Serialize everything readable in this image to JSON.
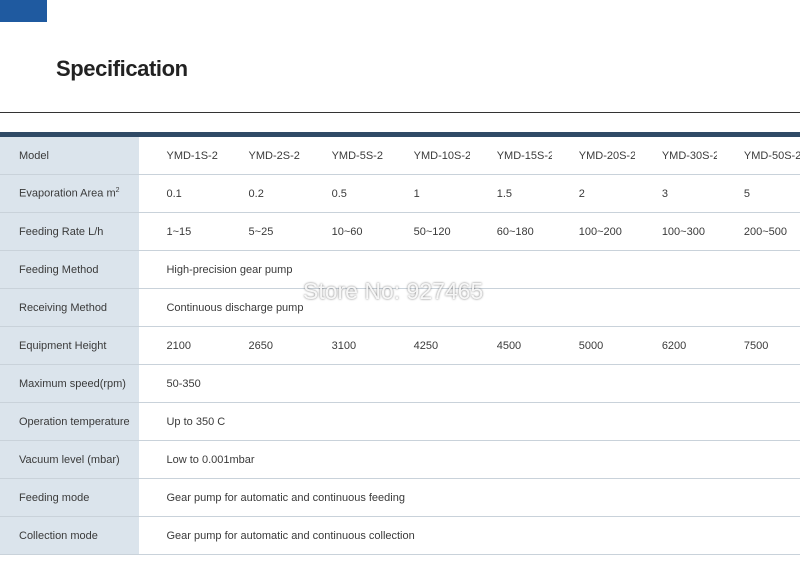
{
  "page": {
    "title": "Specification"
  },
  "watermark": "Store No: 927465",
  "table": {
    "rows": [
      {
        "label": "Model",
        "values": [
          "YMD-1S-2",
          "YMD-2S-2",
          "YMD-5S-2",
          "YMD-10S-2",
          "YMD-15S-2",
          "YMD-20S-2",
          "YMD-30S-2",
          "YMD-50S-2"
        ]
      },
      {
        "label": "Evaporation Area m",
        "label_sup": "2",
        "values": [
          "0.1",
          "0.2",
          "0.5",
          "1",
          "1.5",
          "2",
          "3",
          "5"
        ]
      },
      {
        "label": "Feeding Rate L/h",
        "values": [
          "1~15",
          "5~25",
          "10~60",
          "50~120",
          "60~180",
          "100~200",
          "100~300",
          "200~500"
        ]
      },
      {
        "label": "Feeding Method",
        "value": "High-precision gear pump"
      },
      {
        "label": "Receiving Method",
        "value": "Continuous discharge pump"
      },
      {
        "label": "Equipment Height",
        "values": [
          "2100",
          "2650",
          "3100",
          "4250",
          "4500",
          "5000",
          "6200",
          "7500"
        ]
      },
      {
        "label": "Maximum speed(rpm)",
        "value": "50-350"
      },
      {
        "label": "Operation temperature",
        "value": "Up to 350  C"
      },
      {
        "label": "Vacuum level (mbar)",
        "value": "Low to 0.001mbar"
      },
      {
        "label": "Feeding mode",
        "value": "Gear pump for automatic and continuous feeding"
      },
      {
        "label": "Collection mode",
        "value": "Gear pump for automatic and continuous collection"
      }
    ]
  }
}
